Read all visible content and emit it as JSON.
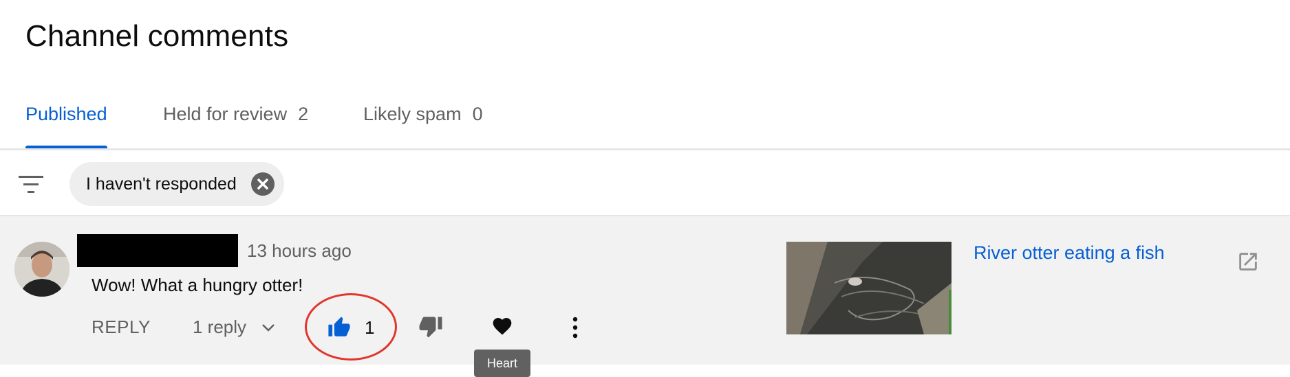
{
  "page": {
    "title": "Channel comments"
  },
  "tabs": [
    {
      "label": "Published",
      "count": ""
    },
    {
      "label": "Held for review",
      "count": "2"
    },
    {
      "label": "Likely spam",
      "count": "0"
    }
  ],
  "filter": {
    "chip_label": "I haven't responded"
  },
  "comment": {
    "timestamp": "13 hours ago",
    "text": "Wow! What a hungry otter!",
    "reply_label": "REPLY",
    "replies_label": "1 reply",
    "like_count": "1",
    "tooltip": "Heart",
    "video_title": "River otter eating a fish"
  },
  "colors": {
    "accent": "#065fd4",
    "annotation": "#e0362c"
  }
}
